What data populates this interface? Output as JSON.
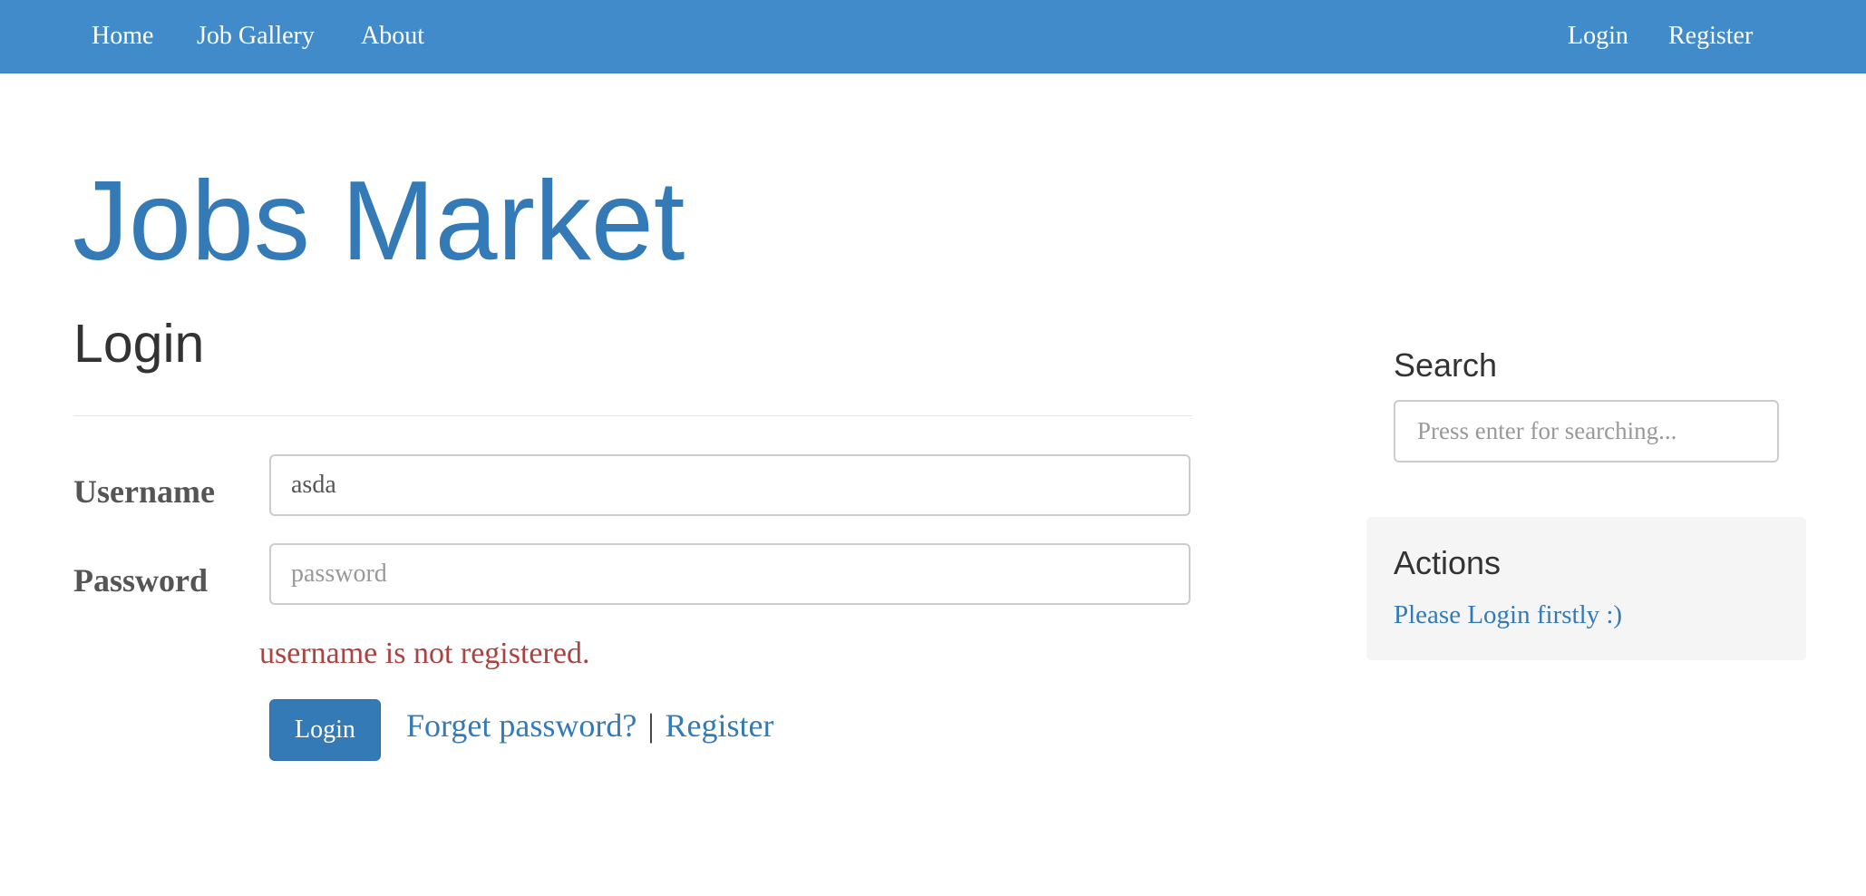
{
  "nav": {
    "left": [
      "Home",
      "Job Gallery",
      "About"
    ],
    "right": [
      "Login",
      "Register"
    ],
    "bg_color": "#428bca"
  },
  "brand": {
    "title": "Jobs Market",
    "color": "#337ab7"
  },
  "main": {
    "title": "Login",
    "form": {
      "username_label": "Username",
      "username_value": "asda",
      "password_label": "Password",
      "password_placeholder": "password",
      "error": "username is not registered.",
      "error_color": "#a94442",
      "submit_label": "Login",
      "forget_link": "Forget password?",
      "separator": "|",
      "register_link": "Register"
    }
  },
  "sidebar": {
    "search": {
      "heading": "Search",
      "placeholder": "Press enter for searching..."
    },
    "actions": {
      "heading": "Actions",
      "message": "Please Login firstly :)"
    }
  }
}
